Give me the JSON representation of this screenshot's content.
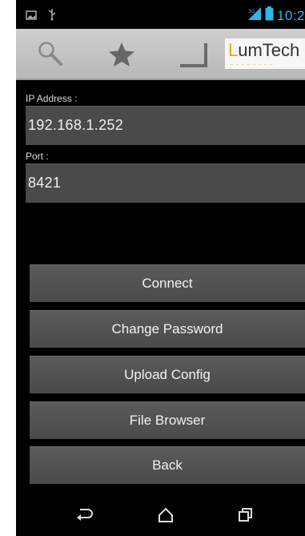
{
  "status_bar": {
    "icons": [
      "image-icon",
      "usb-icon",
      "signal-icon",
      "battery-icon"
    ],
    "time": "10:2"
  },
  "action_bar": {
    "icons": [
      "search-icon",
      "star-icon",
      "bracket-icon"
    ],
    "logo": {
      "text_accent": "L",
      "text_main": "umTech"
    }
  },
  "form": {
    "ip_label": "IP Address :",
    "ip_value": "192.168.1.252",
    "port_label": "Port :",
    "port_value": "8421"
  },
  "buttons": {
    "connect": "Connect",
    "change_password": "Change Password",
    "upload_config": "Upload Config",
    "file_browser": "File Browser",
    "back": "Back"
  },
  "nav_bar": {
    "icons": [
      "back-icon",
      "home-icon",
      "recent-apps-icon"
    ]
  },
  "colors": {
    "accent": "#33b5e5",
    "background": "#000000",
    "field": "#4a4a4a",
    "button": "#505050",
    "logo_accent": "#f2a400"
  }
}
